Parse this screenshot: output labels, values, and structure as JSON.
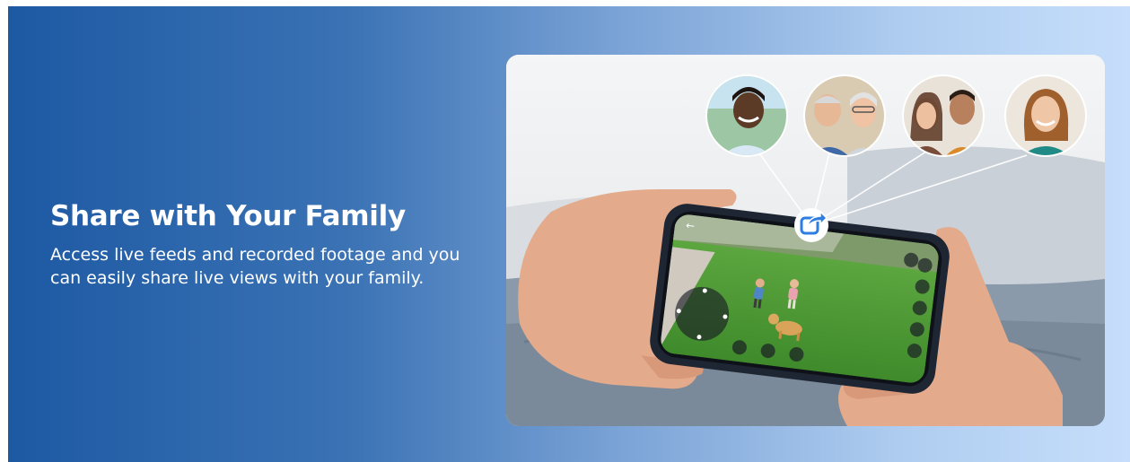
{
  "feature": {
    "title": "Share with Your Family",
    "description": "Access live feeds and recorded footage and you can easily share live views with your family."
  },
  "colors": {
    "gradient_start": "#1d59a3",
    "gradient_end": "#c6defb",
    "text": "#ffffff",
    "share_icon_accent": "#2f7de1",
    "lawn_green": "#4e9a36"
  },
  "illustration": {
    "share_icon": "share-icon",
    "family_avatars": [
      "young man",
      "older couple",
      "young couple",
      "older woman"
    ]
  }
}
